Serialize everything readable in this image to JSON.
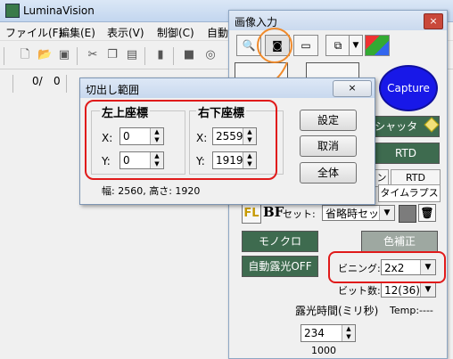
{
  "app": {
    "title": "LuminaVision"
  },
  "menu": [
    "ファイル(F)",
    "編集(E)",
    "表示(V)",
    "制御(C)",
    "自動"
  ],
  "toolbar2": {
    "frame_value": "0/",
    "frame_total": "0"
  },
  "panel": {
    "title": "画像入力",
    "close_label": "×",
    "capture_label": "Capture",
    "shutter_label": "シャッタ",
    "rtd_label": "RTD",
    "tabs": [
      "ン",
      "RTD",
      "タイムラプス"
    ],
    "fl_label": "FL",
    "bf_label": "BF",
    "set_label": "セット:",
    "set_value": "省略時セット",
    "mono_label": "モノクロ",
    "color_correct_label": "色補正",
    "auto_exposure_label": "自動露光OFF",
    "binning_label": "ビニング:",
    "binning_value": "2x2",
    "bitdepth_label": "ビット数:",
    "bitdepth_value": "12(36)",
    "exposure_label": "露光時間(ミリ秒)",
    "temp_label": "Temp:----",
    "exposure_value": "234",
    "exposure_max": "1000"
  },
  "dialog": {
    "title": "切出し範囲",
    "close_label": "×",
    "top_left": {
      "label": "左上座標",
      "x_label": "X:",
      "x": "0",
      "y_label": "Y:",
      "y": "0"
    },
    "bottom_right": {
      "label": "右下座標",
      "x_label": "X:",
      "x": "2559",
      "y_label": "Y:",
      "y": "1919"
    },
    "buttons": {
      "set": "設定",
      "cancel": "取消",
      "all": "全体"
    },
    "size_text": "幅: 2560, 高さ: 1920"
  },
  "colors": {
    "annotation_red": "#e01a1a",
    "annotation_orange": "#f08a2a",
    "capture_blue": "#1818e8",
    "button_green": "#3e6b4f"
  }
}
